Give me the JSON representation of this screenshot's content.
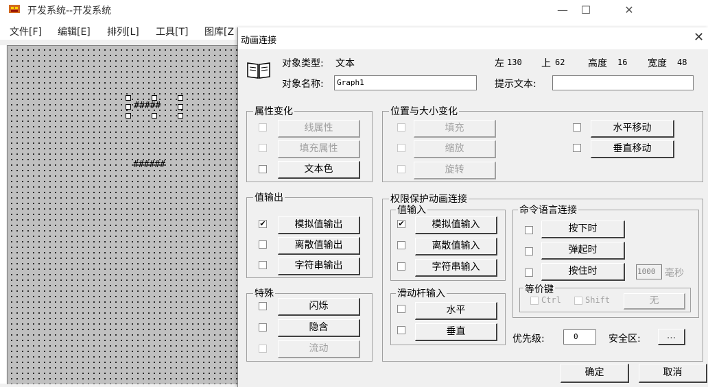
{
  "main_window": {
    "title": "开发系统--开发系统",
    "minimize": "—",
    "maximize": "☐",
    "close": "✕",
    "menu": [
      "文件[F]",
      "编辑[E]",
      "排列[L]",
      "工具[T]",
      "图库[Z"
    ],
    "canvas": {
      "graph_text_selected": "#####",
      "graph_text_2": "######"
    }
  },
  "dialog": {
    "title": "动画连接",
    "close": "✕",
    "info": {
      "type_label": "对象类型:",
      "type_value": "文本",
      "name_label": "对象名称:",
      "name_value": "Graph1",
      "left_label": "左",
      "left_value": "130",
      "top_label": "上",
      "top_value": "62",
      "height_label": "高度",
      "height_value": "16",
      "width_label": "宽度",
      "width_value": "48",
      "hint_label": "提示文本:",
      "hint_value": ""
    },
    "attr_group": {
      "title": "属性变化",
      "items": [
        "线属性",
        "填充属性",
        "文本色"
      ]
    },
    "pos_group": {
      "title": "位置与大小变化",
      "left_items": [
        "填充",
        "缩放",
        "旋转"
      ],
      "right_items": [
        "水平移动",
        "垂直移动"
      ]
    },
    "output_group": {
      "title": "值输出",
      "items": [
        "模拟值输出",
        "离散值输出",
        "字符串输出"
      ],
      "checked": [
        true,
        false,
        false
      ]
    },
    "special_group": {
      "title": "特殊",
      "items": [
        "闪烁",
        "隐含",
        "流动"
      ]
    },
    "perm_group": {
      "title": "权限保护动画连接",
      "input_title": "值输入",
      "input_items": [
        "模拟值输入",
        "离散值输入",
        "字符串输入"
      ],
      "input_checked": [
        true,
        false,
        false
      ],
      "slider_title": "滑动杆输入",
      "slider_items": [
        "水平",
        "垂直"
      ],
      "cmd_title": "命令语言连接",
      "cmd_items": [
        "按下时",
        "弹起时",
        "按住时"
      ],
      "hold_ms_value": "1000",
      "hold_ms_unit": "毫秒",
      "equiv_title": "等价键",
      "ctrl_label": "Ctrl",
      "shift_label": "Shift",
      "none_label": "无",
      "priority_label": "优先级:",
      "priority_value": "0",
      "security_label": "安全区:",
      "security_button": "..."
    },
    "ok": "确定",
    "cancel": "取消"
  }
}
